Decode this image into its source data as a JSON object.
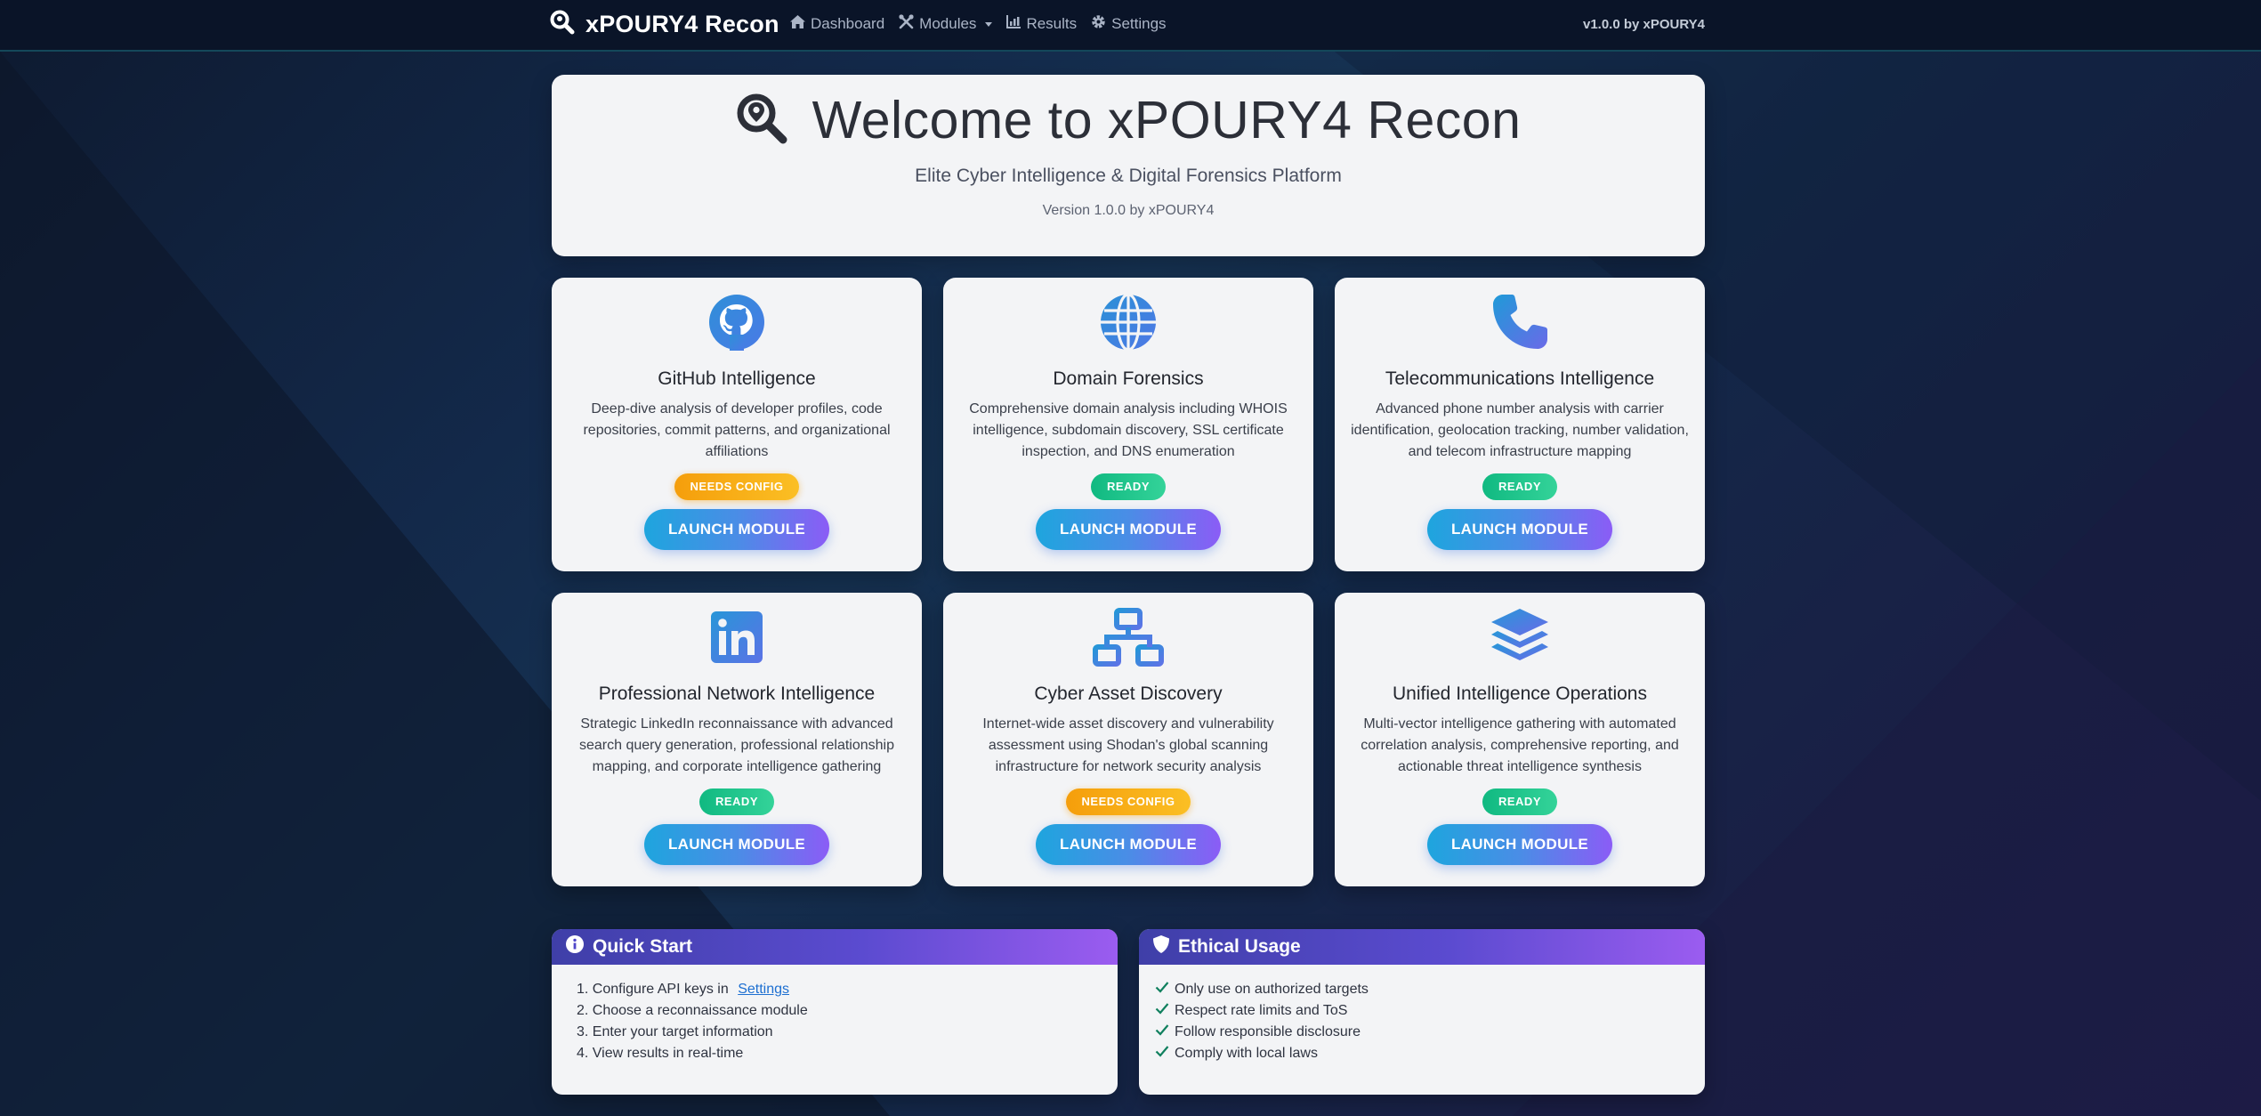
{
  "navbar": {
    "brand": "xPOURY4 Recon",
    "links": [
      {
        "label": "Dashboard",
        "icon": "home-icon"
      },
      {
        "label": "Modules",
        "icon": "tools-icon"
      },
      {
        "label": "Results",
        "icon": "chart-icon"
      },
      {
        "label": "Settings",
        "icon": "gear-icon"
      }
    ],
    "version": "v1.0.0 by xPOURY4"
  },
  "hero": {
    "title": "Welcome to xPOURY4 Recon",
    "subtitle": "Elite Cyber Intelligence & Digital Forensics Platform",
    "version": "Version 1.0.0 by xPOURY4"
  },
  "modules": [
    {
      "title": "GitHub Intelligence",
      "description": "Deep-dive analysis of developer profiles, code repositories, commit patterns, and organizational affiliations",
      "status": "NEEDS CONFIG",
      "status_type": "config",
      "button": "LAUNCH MODULE",
      "icon": "github-icon"
    },
    {
      "title": "Domain Forensics",
      "description": "Comprehensive domain analysis including WHOIS intelligence, subdomain discovery, SSL certificate inspection, and DNS enumeration",
      "status": "READY",
      "status_type": "ready",
      "button": "LAUNCH MODULE",
      "icon": "globe-icon"
    },
    {
      "title": "Telecommunications Intelligence",
      "description": "Advanced phone number analysis with carrier identification, geolocation tracking, number validation, and telecom infrastructure mapping",
      "status": "READY",
      "status_type": "ready",
      "button": "LAUNCH MODULE",
      "icon": "phone-icon"
    },
    {
      "title": "Professional Network Intelligence",
      "description": "Strategic LinkedIn reconnaissance with advanced search query generation, professional relationship mapping, and corporate intelligence gathering",
      "status": "READY",
      "status_type": "ready",
      "button": "LAUNCH MODULE",
      "icon": "linkedin-icon"
    },
    {
      "title": "Cyber Asset Discovery",
      "description": "Internet-wide asset discovery and vulnerability assessment using Shodan's global scanning infrastructure for network security analysis",
      "status": "NEEDS CONFIG",
      "status_type": "config",
      "button": "LAUNCH MODULE",
      "icon": "network-icon"
    },
    {
      "title": "Unified Intelligence Operations",
      "description": "Multi-vector intelligence gathering with automated correlation analysis, comprehensive reporting, and actionable threat intelligence synthesis",
      "status": "READY",
      "status_type": "ready",
      "button": "LAUNCH MODULE",
      "icon": "layers-icon"
    }
  ],
  "quick_start": {
    "title": "Quick Start",
    "steps": [
      {
        "prefix": "1. Configure API keys in ",
        "link": "Settings"
      },
      {
        "prefix": "2. Choose a reconnaissance module"
      },
      {
        "prefix": "3. Enter your target information"
      },
      {
        "prefix": "4. View results in real-time"
      }
    ]
  },
  "ethical_usage": {
    "title": "Ethical Usage",
    "items": [
      "Only use on authorized targets",
      "Respect rate limits and ToS",
      "Follow responsible disclosure",
      "Comply with local laws"
    ]
  },
  "colors": {
    "navbar_bg": "#0a1428",
    "card_bg": "#f3f4f6",
    "ready": "#10b981",
    "needs_config": "#f59e0b",
    "button_start": "#1ea5de",
    "button_end": "#8b5cf6",
    "header_start": "#3f3fa8",
    "header_end": "#9b5cf0"
  }
}
